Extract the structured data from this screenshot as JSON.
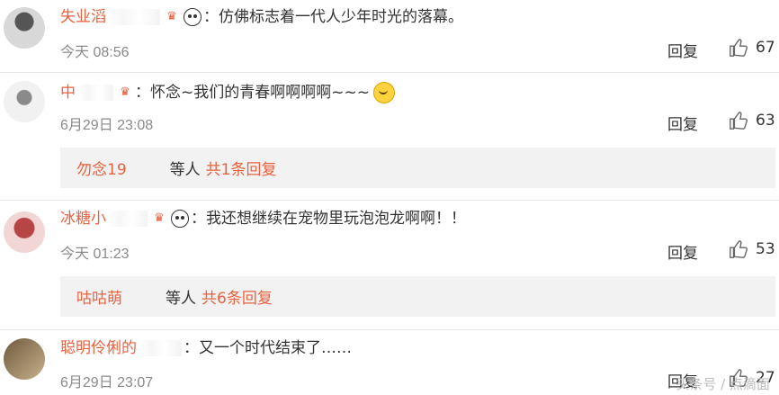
{
  "comments": [
    {
      "name": "失业滔",
      "content": "：仿佛标志着一代人少年时光的落幕。",
      "time": "今天 08:56",
      "reply_label": "回复",
      "likes": "67"
    },
    {
      "name": "中",
      "content": "：怀念~我们的青春啊啊啊啊~~~",
      "time": "6月29日 23:08",
      "reply_label": "回复",
      "likes": "63",
      "sub_reply": {
        "user": "勿念19",
        "etc": "等人",
        "link": "共1条回复"
      }
    },
    {
      "name": "冰糖小",
      "content": "：我还想继续在宠物里玩泡泡龙啊啊！！",
      "time": "今天 01:23",
      "reply_label": "回复",
      "likes": "53",
      "sub_reply": {
        "user": "咕咕萌",
        "etc": "等人",
        "link": "共6条回复"
      }
    },
    {
      "name": "聪明伶俐的",
      "content": "：又一个时代结束了……",
      "time": "6月29日 23:07",
      "reply_label": "回复",
      "likes": "27"
    }
  ],
  "watermark": "头条号 / 点滴面"
}
